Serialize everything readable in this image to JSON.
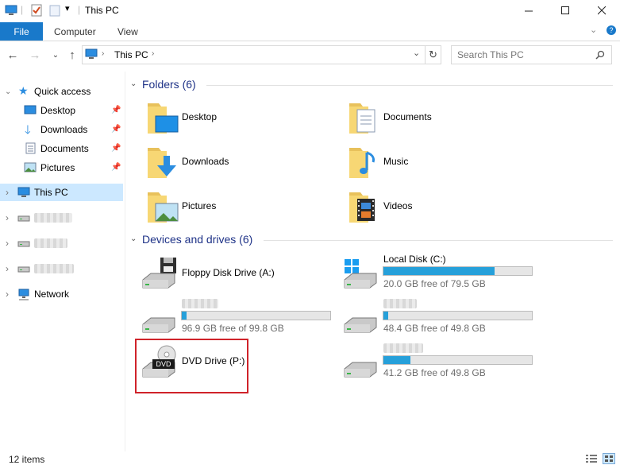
{
  "window": {
    "title": "This PC"
  },
  "ribbon": {
    "file": "File",
    "tabs": [
      "Computer",
      "View"
    ]
  },
  "address": {
    "path": "This PC"
  },
  "search": {
    "placeholder": "Search This PC"
  },
  "nav": {
    "quick_access": "Quick access",
    "qa_items": [
      "Desktop",
      "Downloads",
      "Documents",
      "Pictures"
    ],
    "this_pc": "This PC",
    "network": "Network"
  },
  "folders": {
    "header": "Folders (6)",
    "items": [
      "Desktop",
      "Documents",
      "Downloads",
      "Music",
      "Pictures",
      "Videos"
    ]
  },
  "devices": {
    "header": "Devices and drives (6)",
    "floppy": "Floppy Disk Drive (A:)",
    "local_disk": {
      "label": "Local Disk (C:)",
      "free": "20.0 GB free of 79.5 GB",
      "used_fraction": 0.75
    },
    "drive2": {
      "free": "96.9 GB free of 99.8 GB",
      "used_fraction": 0.03
    },
    "drive3": {
      "free": "48.4 GB free of 49.8 GB",
      "used_fraction": 0.03
    },
    "dvd": {
      "label": "DVD Drive (P:)",
      "badge": "DVD"
    },
    "drive5": {
      "free": "41.2 GB free of 49.8 GB",
      "used_fraction": 0.18
    }
  },
  "status": {
    "count": "12 items"
  },
  "colors": {
    "accent": "#1979ca",
    "selection": "#cce8ff",
    "bar_fill": "#26a0da",
    "highlight_border": "#d0232a"
  }
}
